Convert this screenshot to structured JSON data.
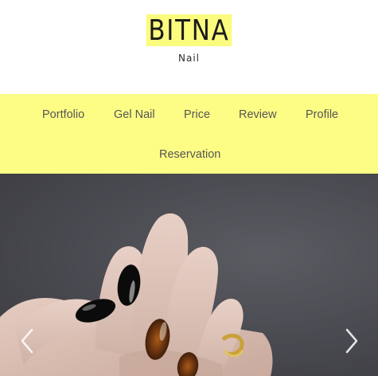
{
  "brand": {
    "name": "BITNA",
    "tagline": "Nail",
    "highlight_color": "#fbfb7e"
  },
  "nav": {
    "background_color": "#fdfd86",
    "items": [
      {
        "label": "Portfolio"
      },
      {
        "label": "Gel Nail"
      },
      {
        "label": "Price"
      },
      {
        "label": "Review"
      },
      {
        "label": "Profile"
      },
      {
        "label": "Reservation"
      }
    ]
  },
  "slider": {
    "image": "hand-with-black-and-tortoiseshell-nails",
    "prev_icon": "chevron-left-icon",
    "next_icon": "chevron-right-icon"
  }
}
